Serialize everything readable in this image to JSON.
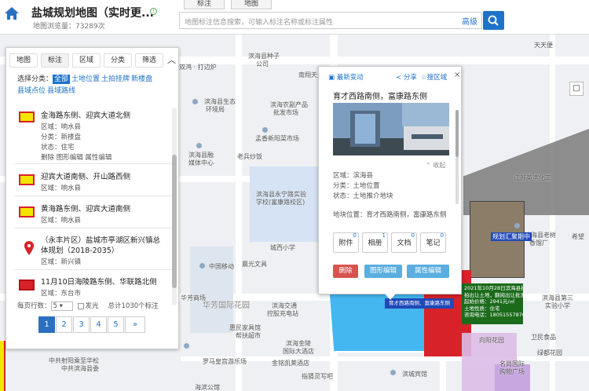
{
  "header": {
    "title": "盐城规划地图（实时更...",
    "views": "地图浏览量：73289次",
    "tabs": [
      "标注",
      "地图"
    ],
    "search_placeholder": "地图标注信息搜索，可输入标注名称或标注属性",
    "advanced": "高级"
  },
  "map_labels": {
    "l1": "双鸿 · 打边炉",
    "l2": "滨海县种子",
    "l3": "公司",
    "l4": "南翔天天",
    "l5": "滨海县生态",
    "l6": "环境局",
    "l7": "滨海农副产品",
    "l8": "批发市场",
    "l9": "孟香新阳菜市场",
    "l10": "滨海县融",
    "l11": "媒体中心",
    "l12": "老兵炒饭",
    "l13": "滨海县永宁路实验",
    "l14": "学校(富康路校区)",
    "l15": "城西小学",
    "l16": "中国移动",
    "l17": "晨光文具",
    "l18": "华芳国际花园",
    "l19": "华芳商场",
    "l20": "滨海交通",
    "l21": "控股充电站",
    "l22": "惠民家具馆",
    "l23": "帮扶超市",
    "l24": "滨海金陵",
    "l25": "国际大酒店",
    "l26": "中共滨海县委",
    "l27": "会议中心",
    "l28": "罗马皇宫游乐场",
    "l29": "金铭凯莱酒店",
    "l30": "滨城宾馆",
    "l31": "指猜灵写吧",
    "l32": "江苏英滨化工",
    "l33": "滨海县老树",
    "l34": "香馏厂",
    "l35": "希望",
    "l36": "滨海县第三",
    "l37": "实验小学",
    "l38": "卫民食品",
    "l39": "向阳花园",
    "l40": "名尚国际",
    "l41": "购物广场",
    "l42": "绿都花园",
    "l43": "中共射阳乘至华松",
    "l44": "海滨公馆",
    "l45": "天天便",
    "l46": "规划汇聚期中",
    "l47": "育才西路南侧、富康路东侧"
  },
  "annotation": {
    "lines": [
      "2021年10月28日滨海县挂",
      "拍出让土地，翻阅出让批准号",
      "起始价格：2941元/㎡",
      "土地性质：住宅",
      "咨询电话：18051557870"
    ]
  },
  "panel": {
    "tabs": [
      "地图",
      "标注",
      "区域",
      "分类",
      "筛选"
    ],
    "filter_label": "选择分类：",
    "filter_selected": "全部",
    "filters": [
      "土地位置",
      "土拍挂牌",
      "新楼盘",
      "县域点位",
      "县域路线"
    ],
    "items": [
      {
        "title": "金海路东侧、迎宾大道北侧",
        "region": "区域：响水县",
        "category": "分类：新楼盘",
        "status": "状态：住宅",
        "actions": "删除  图形编辑  属性编辑"
      },
      {
        "title": "迎宾大道南侧、开山路西侧",
        "region": "区域：响水县"
      },
      {
        "title": "黄海路东侧、迎宾大道南侧",
        "region": "区域：响水县"
      },
      {
        "title": "（永丰片区）盐城市亭湖区新兴镇总",
        "title2": "体规划（2018-2035）",
        "region": "区域：新兴镇"
      },
      {
        "title": "11月10日海陵路东侧、华联路北侧",
        "region": "区域：东台市"
      }
    ],
    "per_page_label": "每页行数：",
    "per_page": "5",
    "show_flash": "发光",
    "total": "总计1030个标注",
    "pages": [
      "1",
      "2",
      "3",
      "4",
      "5",
      "»"
    ]
  },
  "popup": {
    "header": [
      "最新变动",
      "分享",
      "搜区域"
    ],
    "title": "育才西路南侧，富康路东侧",
    "collapse": "收起",
    "region": "区域：滨海县",
    "category": "分类：土地位置",
    "status": "状态：土地推介地块",
    "location": "地块位置：育才西路南侧，富康路东侧",
    "buttons": [
      {
        "label": "附件",
        "count": "0"
      },
      {
        "label": "相册",
        "count": "1"
      },
      {
        "label": "文档",
        "count": "0"
      },
      {
        "label": "笔记",
        "count": "0"
      }
    ],
    "delete": "删除",
    "edit_shape": "图形编辑",
    "edit_attr": "属性编辑"
  },
  "colors": {
    "accent": "#1e73c8",
    "red": "#d8222a",
    "yellow": "#f2e600"
  }
}
